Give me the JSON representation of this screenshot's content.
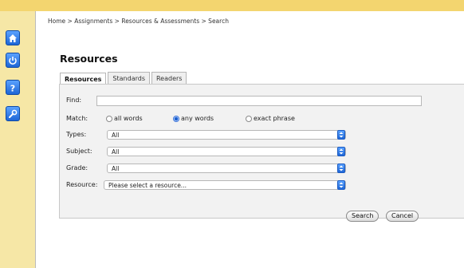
{
  "breadcrumb": "Home > Assignments > Resources & Assessments > Search",
  "page_title": "Resources",
  "tabs": [
    {
      "label": "Resources",
      "active": true
    },
    {
      "label": "Standards",
      "active": false
    },
    {
      "label": "Readers",
      "active": false
    }
  ],
  "form": {
    "find_label": "Find:",
    "find_value": "",
    "match_label": "Match:",
    "match_options": [
      {
        "label": "all words",
        "selected": false
      },
      {
        "label": "any words",
        "selected": true
      },
      {
        "label": "exact phrase",
        "selected": false
      }
    ],
    "types_label": "Types:",
    "types_value": "All",
    "subject_label": "Subject:",
    "subject_value": "All",
    "grade_label": "Grade:",
    "grade_value": "All",
    "resource_label": "Resource:",
    "resource_value": "Please select a resource..."
  },
  "buttons": {
    "search": "Search",
    "cancel": "Cancel"
  },
  "rail_icons": [
    "home-icon",
    "power-icon",
    "help-icon",
    "tools-icon"
  ],
  "colors": {
    "top_bar": "#f3d56f",
    "side_rail": "#f6e7a6",
    "icon_blue": "#1e66d6"
  }
}
